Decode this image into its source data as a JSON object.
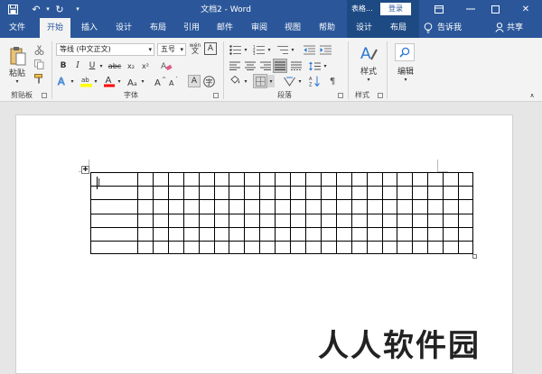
{
  "title_bar": {
    "title": "文档2 - Word",
    "context_label": "表格...",
    "login_label": "登录"
  },
  "tabs": [
    {
      "label": "文件"
    },
    {
      "label": "开始"
    },
    {
      "label": "插入"
    },
    {
      "label": "设计"
    },
    {
      "label": "布局"
    },
    {
      "label": "引用"
    },
    {
      "label": "邮件"
    },
    {
      "label": "审阅"
    },
    {
      "label": "视图"
    },
    {
      "label": "帮助"
    },
    {
      "label": "设计"
    },
    {
      "label": "布局"
    }
  ],
  "tell_me": "告诉我",
  "share": "共享",
  "ribbon": {
    "clipboard": {
      "paste": "粘贴",
      "group": "剪贴板"
    },
    "font": {
      "font_name": "等线 (中文正文)",
      "font_size": "五号",
      "wen": "wén",
      "group": "字体"
    },
    "paragraph": {
      "group": "段落"
    },
    "styles": {
      "label": "样式",
      "group": "样式"
    },
    "editing": {
      "label": "编辑"
    }
  },
  "document": {
    "table_rows": 6,
    "table_cols": 23
  },
  "watermark": "人人软件园",
  "colors": {
    "accent": "#2b579a",
    "context": "#1e4a84",
    "highlight": "#ffff00",
    "font_color": "#ff0000"
  }
}
